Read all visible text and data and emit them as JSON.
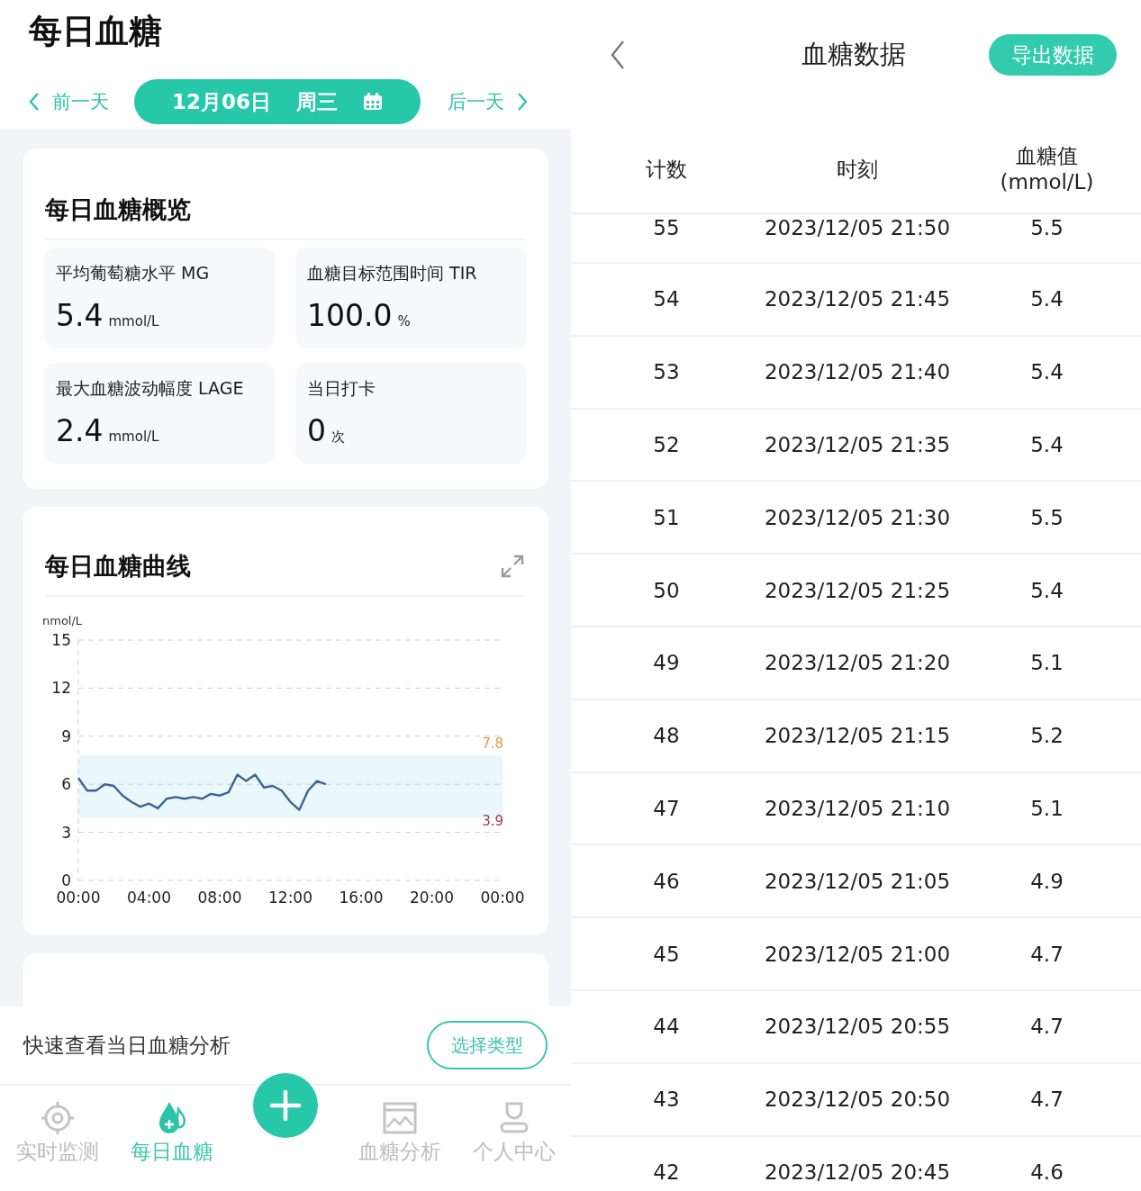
{
  "header": {
    "title": "每日血糖",
    "prev_day": "前一天",
    "date": "12月06日",
    "weekday": "周三",
    "next_day": "后一天"
  },
  "overview": {
    "title": "每日血糖概览",
    "metrics": [
      {
        "label": "平均葡萄糖水平 MG",
        "value": "5.4",
        "unit": "mmol/L"
      },
      {
        "label": "血糖目标范围时间 TIR",
        "value": "100.0",
        "unit": "%"
      },
      {
        "label": "最大血糖波动幅度 LAGE",
        "value": "2.4",
        "unit": "mmol/L"
      },
      {
        "label": "当日打卡",
        "value": "0",
        "unit": "次"
      }
    ]
  },
  "curve": {
    "title": "每日血糖曲线",
    "chart_data": {
      "type": "line",
      "ylabel": "nmol/L",
      "x": [
        0,
        0.5,
        1,
        1.5,
        2,
        2.5,
        3,
        3.5,
        4,
        4.5,
        5,
        5.5,
        6,
        6.5,
        7,
        7.5,
        8,
        8.5,
        9,
        9.5,
        10,
        10.5,
        11,
        11.5,
        12,
        12.5,
        13,
        13.5,
        14
      ],
      "series": [
        {
          "color": "#3d6494",
          "values": [
            6.4,
            5.6,
            5.6,
            6.0,
            5.9,
            5.3,
            4.9,
            4.6,
            4.8,
            4.5,
            5.1,
            5.2,
            5.1,
            5.2,
            5.1,
            5.4,
            5.3,
            5.5,
            6.6,
            6.2,
            6.6,
            5.8,
            5.9,
            5.6,
            4.9,
            4.4,
            5.6,
            6.2,
            6.0
          ]
        }
      ],
      "xlim": [
        0,
        24
      ],
      "ylim": [
        0,
        15
      ],
      "xticks": [
        {
          "value": 0,
          "label": "00:00"
        },
        {
          "value": 4,
          "label": "04:00"
        },
        {
          "value": 8,
          "label": "08:00"
        },
        {
          "value": 12,
          "label": "12:00"
        },
        {
          "value": 16,
          "label": "16:00"
        },
        {
          "value": 20,
          "label": "20:00"
        },
        {
          "value": 24,
          "label": "00:00"
        }
      ],
      "yticks": [
        0,
        3,
        6,
        9,
        12,
        15
      ],
      "grid": true,
      "bands": [
        {
          "axis": "y",
          "from": 3.9,
          "to": 7.8,
          "color": "#eaf8fb"
        }
      ],
      "annotations": [
        "7.8",
        "3.9"
      ]
    }
  },
  "quick_bar": {
    "text": "快速查看当日血糖分析",
    "button": "选择类型"
  },
  "bottom_nav": [
    {
      "label": "实时监测",
      "kind": "target",
      "selected": false
    },
    {
      "label": "每日血糖",
      "kind": "drops",
      "selected": true
    },
    {
      "label": "血糖分析",
      "kind": "chart",
      "selected": false
    },
    {
      "label": "个人中心",
      "kind": "person",
      "selected": false
    }
  ],
  "data_screen": {
    "title": "血糖数据",
    "export_button": "导出数据",
    "columns": [
      "计数",
      "时刻",
      "血糖值\n(mmol/L)"
    ],
    "rows": [
      {
        "count": "55",
        "time": "2023/12/05 21:50",
        "value": "5.5"
      },
      {
        "count": "54",
        "time": "2023/12/05 21:45",
        "value": "5.4"
      },
      {
        "count": "53",
        "time": "2023/12/05 21:40",
        "value": "5.4"
      },
      {
        "count": "52",
        "time": "2023/12/05 21:35",
        "value": "5.4"
      },
      {
        "count": "51",
        "time": "2023/12/05 21:30",
        "value": "5.5"
      },
      {
        "count": "50",
        "time": "2023/12/05 21:25",
        "value": "5.4"
      },
      {
        "count": "49",
        "time": "2023/12/05 21:20",
        "value": "5.1"
      },
      {
        "count": "48",
        "time": "2023/12/05 21:15",
        "value": "5.2"
      },
      {
        "count": "47",
        "time": "2023/12/05 21:10",
        "value": "5.1"
      },
      {
        "count": "46",
        "time": "2023/12/05 21:05",
        "value": "4.9"
      },
      {
        "count": "45",
        "time": "2023/12/05 21:00",
        "value": "4.7"
      },
      {
        "count": "44",
        "time": "2023/12/05 20:55",
        "value": "4.7"
      },
      {
        "count": "43",
        "time": "2023/12/05 20:50",
        "value": "4.7"
      },
      {
        "count": "42",
        "time": "2023/12/05 20:45",
        "value": "4.6"
      }
    ]
  }
}
